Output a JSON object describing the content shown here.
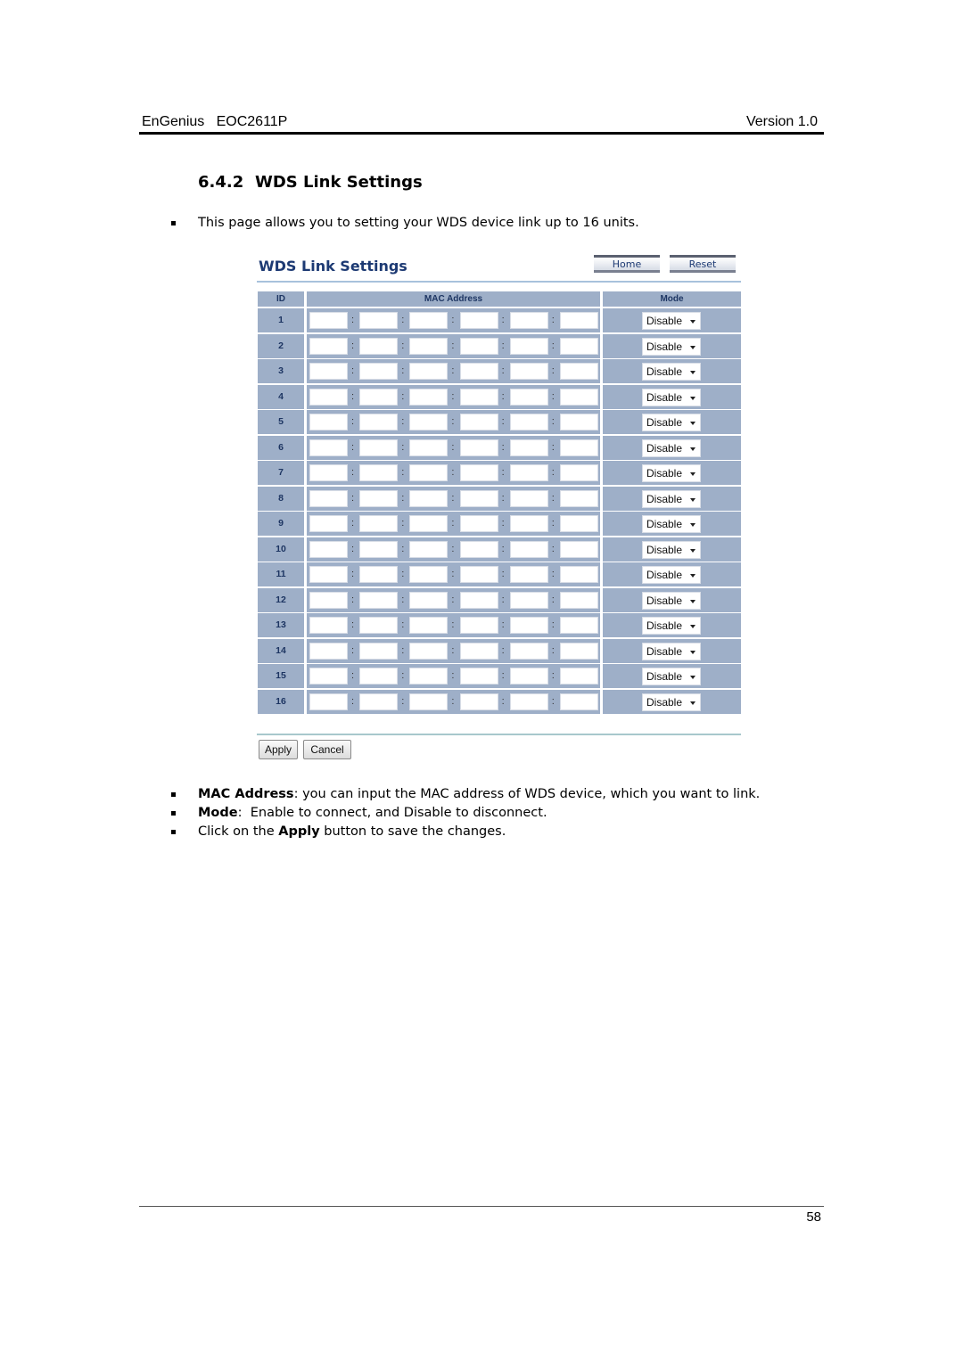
{
  "header": {
    "brand": "EnGenius   EOC2611P",
    "version": "Version 1.0"
  },
  "section": {
    "number": "6.4.2",
    "title": "WDS Link Settings"
  },
  "intro": "This page allows you to setting your WDS device link up to 16 units.",
  "ui": {
    "title": "WDS Link Settings",
    "home_label": "Home",
    "reset_label": "Reset",
    "columns": {
      "id": "ID",
      "mac": "MAC Address",
      "mode": "Mode"
    },
    "mac_separator": ":",
    "rows": [
      {
        "id": "1",
        "mac": [
          "",
          "",
          "",
          "",
          "",
          ""
        ],
        "mode": "Disable"
      },
      {
        "id": "2",
        "mac": [
          "",
          "",
          "",
          "",
          "",
          ""
        ],
        "mode": "Disable"
      },
      {
        "id": "3",
        "mac": [
          "",
          "",
          "",
          "",
          "",
          ""
        ],
        "mode": "Disable"
      },
      {
        "id": "4",
        "mac": [
          "",
          "",
          "",
          "",
          "",
          ""
        ],
        "mode": "Disable"
      },
      {
        "id": "5",
        "mac": [
          "",
          "",
          "",
          "",
          "",
          ""
        ],
        "mode": "Disable"
      },
      {
        "id": "6",
        "mac": [
          "",
          "",
          "",
          "",
          "",
          ""
        ],
        "mode": "Disable"
      },
      {
        "id": "7",
        "mac": [
          "",
          "",
          "",
          "",
          "",
          ""
        ],
        "mode": "Disable"
      },
      {
        "id": "8",
        "mac": [
          "",
          "",
          "",
          "",
          "",
          ""
        ],
        "mode": "Disable"
      },
      {
        "id": "9",
        "mac": [
          "",
          "",
          "",
          "",
          "",
          ""
        ],
        "mode": "Disable"
      },
      {
        "id": "10",
        "mac": [
          "",
          "",
          "",
          "",
          "",
          ""
        ],
        "mode": "Disable"
      },
      {
        "id": "11",
        "mac": [
          "",
          "",
          "",
          "",
          "",
          ""
        ],
        "mode": "Disable"
      },
      {
        "id": "12",
        "mac": [
          "",
          "",
          "",
          "",
          "",
          ""
        ],
        "mode": "Disable"
      },
      {
        "id": "13",
        "mac": [
          "",
          "",
          "",
          "",
          "",
          ""
        ],
        "mode": "Disable"
      },
      {
        "id": "14",
        "mac": [
          "",
          "",
          "",
          "",
          "",
          ""
        ],
        "mode": "Disable"
      },
      {
        "id": "15",
        "mac": [
          "",
          "",
          "",
          "",
          "",
          ""
        ],
        "mode": "Disable"
      },
      {
        "id": "16",
        "mac": [
          "",
          "",
          "",
          "",
          "",
          ""
        ],
        "mode": "Disable"
      }
    ],
    "apply_label": "Apply",
    "cancel_label": "Cancel"
  },
  "notes": [
    {
      "bold": "MAC Address",
      "prefix": "",
      "rest": ": you can input the MAC address of WDS device, which you want to link."
    },
    {
      "bold": "Mode",
      "prefix": "",
      "rest": ":  Enable to connect, and Disable to disconnect."
    },
    {
      "bold": "Apply",
      "prefix": "Click on the ",
      "rest": " button to save the changes."
    }
  ],
  "page_number": "58"
}
